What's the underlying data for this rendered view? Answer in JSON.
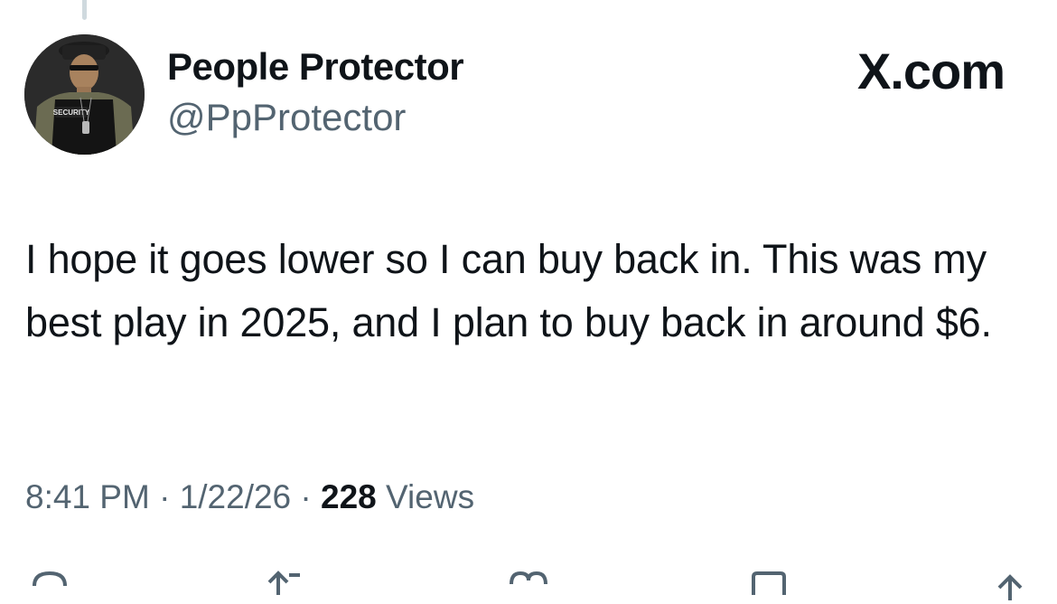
{
  "author": {
    "display_name": "People Protector",
    "handle": "@PpProtector",
    "avatar_badge": "SECURITY"
  },
  "brand": "X.com",
  "tweet": {
    "text": "I hope it goes lower so I can buy back in. This was my best play in 2025, and I plan to buy back in around $6."
  },
  "meta": {
    "time": "8:41 PM",
    "separator": "·",
    "date": "1/22/26",
    "views_count": "228",
    "views_label": "Views"
  },
  "actions": [
    {
      "icon": "reply-icon"
    },
    {
      "icon": "repost-icon"
    },
    {
      "icon": "like-icon"
    },
    {
      "icon": "bookmark-icon"
    },
    {
      "icon": "share-icon"
    }
  ],
  "colors": {
    "text_primary": "#0f1419",
    "text_secondary": "#536471",
    "thread_line": "#cfd9de"
  }
}
